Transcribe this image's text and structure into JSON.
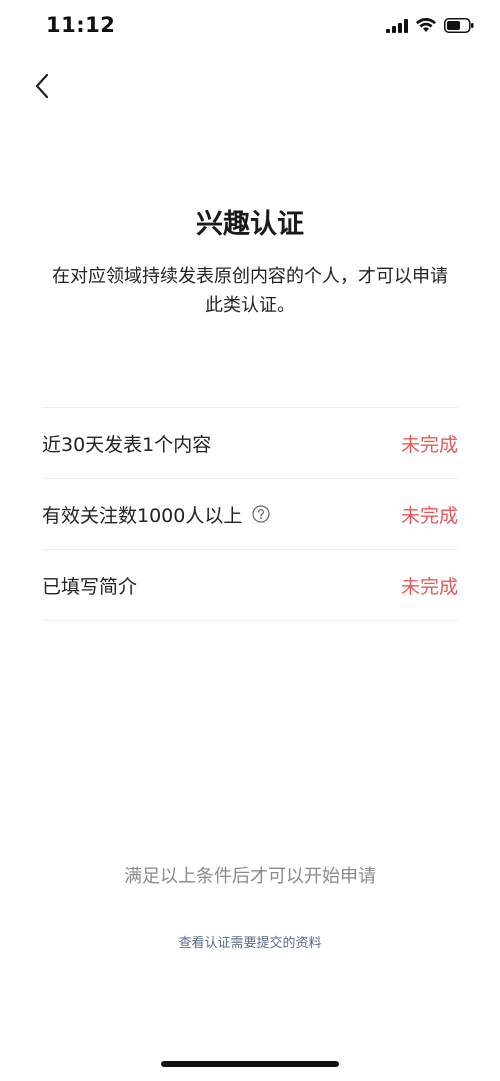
{
  "status_bar": {
    "time": "11:12",
    "icons": [
      "signal-icon",
      "wifi-icon",
      "battery-icon"
    ]
  },
  "header": {
    "back_icon": "chevron-left-icon"
  },
  "main": {
    "title": "兴趣认证",
    "description": "在对应领域持续发表原创内容的个人，才可以申请此类认证。",
    "requirements": [
      {
        "label": "近30天发表1个内容",
        "status": "未完成",
        "has_help": false
      },
      {
        "label": "有效关注数1000人以上",
        "status": "未完成",
        "has_help": true,
        "help_icon": "question-circle-icon"
      },
      {
        "label": "已填写简介",
        "status": "未完成",
        "has_help": false
      }
    ],
    "status_color": "#e8575a"
  },
  "footer": {
    "hint": "满足以上条件后才可以开始申请",
    "materials_link": "查看认证需要提交的资料"
  }
}
